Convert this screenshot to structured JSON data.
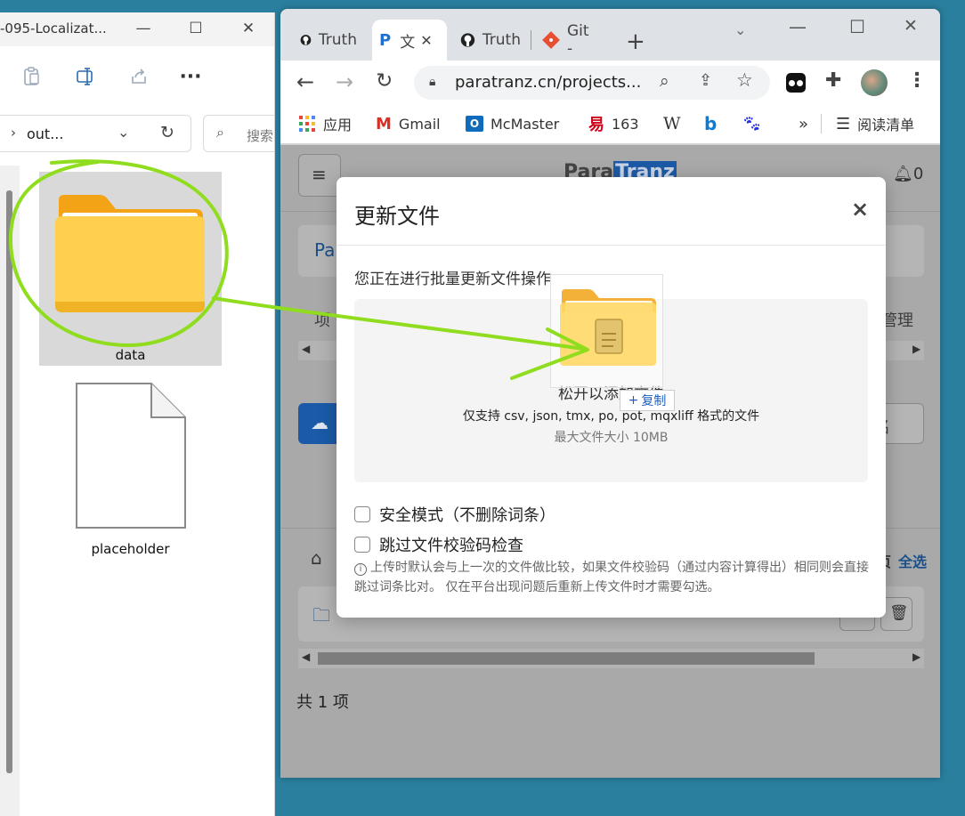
{
  "explorer": {
    "title": "-095-Localizat...",
    "address": "out...",
    "search_placeholder": "搜索",
    "items": [
      {
        "label": "data"
      },
      {
        "label": "placeholder"
      }
    ]
  },
  "browser": {
    "tabs": [
      {
        "label": "Truth"
      },
      {
        "label": "文"
      },
      {
        "label": "Truth"
      },
      {
        "label": "Git -"
      }
    ],
    "url": "paratranz.cn/projects...",
    "bookmarks": [
      {
        "label": "应用"
      },
      {
        "label": "Gmail"
      },
      {
        "label": "McMaster"
      },
      {
        "label": "163"
      },
      {
        "label": ""
      },
      {
        "label": ""
      },
      {
        "label": ""
      }
    ],
    "bookmarks_overflow": "»",
    "reading_list": "阅读清单"
  },
  "page": {
    "logo_left": "Para",
    "logo_right": "Tranz",
    "notifications": "0",
    "card_prefix": "Pa",
    "tab_left": "项",
    "tab_right": "管理",
    "btn_right": "名",
    "breadcrumb_right": "页",
    "select_all": "全选",
    "total": "共 1 项"
  },
  "modal": {
    "title": "更新文件",
    "close": "×",
    "description": "您正在进行批量更新文件操作",
    "drop_main": "松开以添加文件",
    "drop_formats": "仅支持 csv, json, tmx, po, pot, mqxliff 格式的文件",
    "drop_max": "最大文件大小 10MB",
    "option_safe": "安全模式（不删除词条）",
    "option_skip": "跳过文件校验码检查",
    "hint": "上传时默认会与上一次的文件做比较，如果文件校验码（通过内容计算得出）相同则会直接跳过词条比对。 仅在平台出现问题后重新上传文件时才需要勾选。"
  },
  "drag": {
    "copy_label": "复制"
  },
  "colors": {
    "annotation": "#8fdd1e",
    "primary": "#1e6fd0",
    "folder": "#ffc83d"
  }
}
